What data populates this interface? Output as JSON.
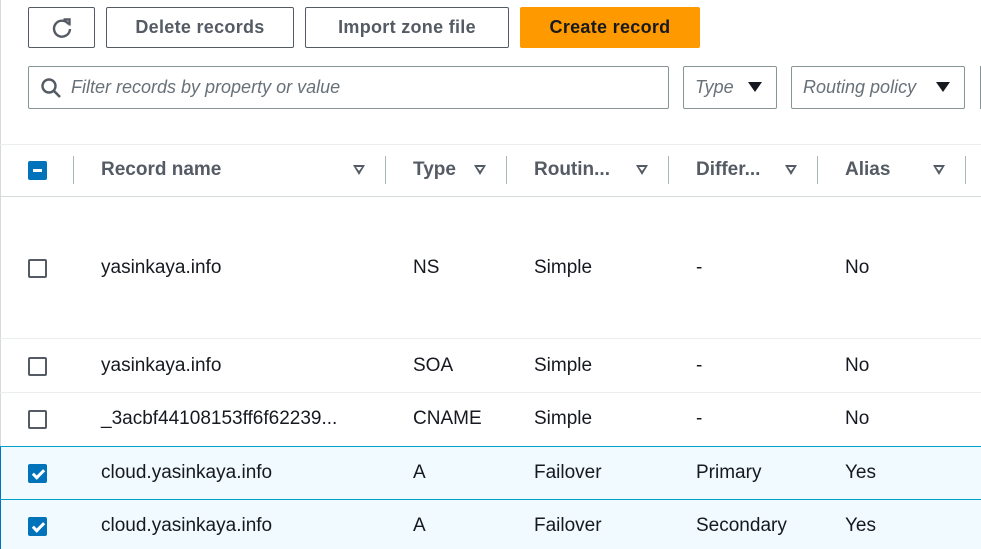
{
  "toolbar": {
    "refresh_icon": "refresh-icon",
    "delete_label": "Delete records",
    "import_label": "Import zone file",
    "create_label": "Create record"
  },
  "filter": {
    "search_placeholder": "Filter records by property or value",
    "type_label": "Type",
    "routing_label": "Routing policy"
  },
  "table": {
    "columns": [
      "Record name",
      "Type",
      "Routin...",
      "Differ...",
      "Alias"
    ],
    "rows": [
      {
        "name": "yasinkaya.info",
        "type": "NS",
        "routing": "Simple",
        "differ": "-",
        "alias": "No",
        "checked": false
      },
      {
        "name": "yasinkaya.info",
        "type": "SOA",
        "routing": "Simple",
        "differ": "-",
        "alias": "No",
        "checked": false
      },
      {
        "name": "_3acbf44108153ff6f62239...",
        "type": "CNAME",
        "routing": "Simple",
        "differ": "-",
        "alias": "No",
        "checked": false
      },
      {
        "name": "cloud.yasinkaya.info",
        "type": "A",
        "routing": "Failover",
        "differ": "Primary",
        "alias": "Yes",
        "checked": true
      },
      {
        "name": "cloud.yasinkaya.info",
        "type": "A",
        "routing": "Failover",
        "differ": "Secondary",
        "alias": "Yes",
        "checked": true
      }
    ]
  },
  "colors": {
    "accent": "#ff9900",
    "selection": "#0073bb"
  }
}
